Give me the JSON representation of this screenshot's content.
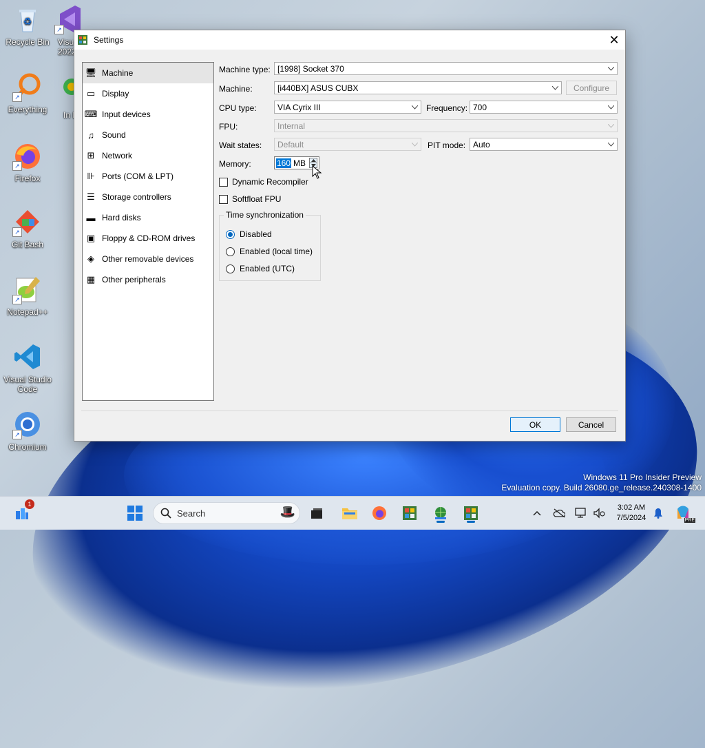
{
  "desktop": {
    "icons": [
      {
        "label": "Recycle Bin",
        "icon": "recycle-bin-icon"
      },
      {
        "label": "Visu 2022",
        "icon": "visual-studio-2022-icon"
      },
      {
        "label": "Everything",
        "icon": "everything-search-icon"
      },
      {
        "label": "In Do",
        "icon": "download-icon"
      },
      {
        "label": "Firefox",
        "icon": "firefox-icon"
      },
      {
        "label": "Git Bash",
        "icon": "git-bash-icon"
      },
      {
        "label": "Notepad++",
        "icon": "notepad-plus-plus-icon"
      },
      {
        "label": "Visual Studio Code",
        "icon": "vscode-icon"
      },
      {
        "label": "Chromium",
        "icon": "chromium-icon"
      }
    ]
  },
  "dialog": {
    "title": "Settings",
    "nav": [
      {
        "label": "Machine",
        "icon": "machine-icon"
      },
      {
        "label": "Display",
        "icon": "display-icon"
      },
      {
        "label": "Input devices",
        "icon": "input-devices-icon"
      },
      {
        "label": "Sound",
        "icon": "sound-icon"
      },
      {
        "label": "Network",
        "icon": "network-icon"
      },
      {
        "label": "Ports (COM & LPT)",
        "icon": "ports-icon"
      },
      {
        "label": "Storage controllers",
        "icon": "storage-controllers-icon"
      },
      {
        "label": "Hard disks",
        "icon": "hard-disk-icon"
      },
      {
        "label": "Floppy & CD-ROM drives",
        "icon": "floppy-cdrom-icon"
      },
      {
        "label": "Other removable devices",
        "icon": "removable-devices-icon"
      },
      {
        "label": "Other peripherals",
        "icon": "peripherals-icon"
      }
    ],
    "selected_nav": "Machine",
    "fields": {
      "machine_type_label": "Machine type:",
      "machine_type_value": "[1998] Socket 370",
      "machine_label": "Machine:",
      "machine_value": "[i440BX] ASUS CUBX",
      "configure_label": "Configure",
      "cpu_type_label": "CPU type:",
      "cpu_type_value": "VIA Cyrix III",
      "frequency_label": "Frequency:",
      "frequency_value": "700",
      "fpu_label": "FPU:",
      "fpu_value": "Internal",
      "wait_states_label": "Wait states:",
      "wait_states_value": "Default",
      "pit_mode_label": "PIT mode:",
      "pit_mode_value": "Auto",
      "memory_label": "Memory:",
      "memory_value": "160",
      "memory_unit": "MB",
      "dynamic_recompiler_label": "Dynamic Recompiler",
      "dynamic_recompiler_checked": false,
      "softfloat_label": "Softfloat FPU",
      "softfloat_checked": false
    },
    "time_sync": {
      "title": "Time synchronization",
      "options": [
        {
          "label": "Disabled",
          "selected": true
        },
        {
          "label": "Enabled (local time)",
          "selected": false
        },
        {
          "label": "Enabled (UTC)",
          "selected": false
        }
      ]
    },
    "ok_label": "OK",
    "cancel_label": "Cancel"
  },
  "watermark": {
    "line1": "Windows 11 Pro Insider Preview",
    "line2": "Evaluation copy. Build 26080.ge_release.240308-1400"
  },
  "taskbar": {
    "search_placeholder": "Search",
    "widget_badge": "1",
    "time": "3:02 AM",
    "date": "7/5/2024",
    "copilot_badge": "PRE"
  },
  "colors": {
    "accent": "#0067c0",
    "selection": "#0078d7",
    "wallpaper_blue": "#1346c0"
  }
}
